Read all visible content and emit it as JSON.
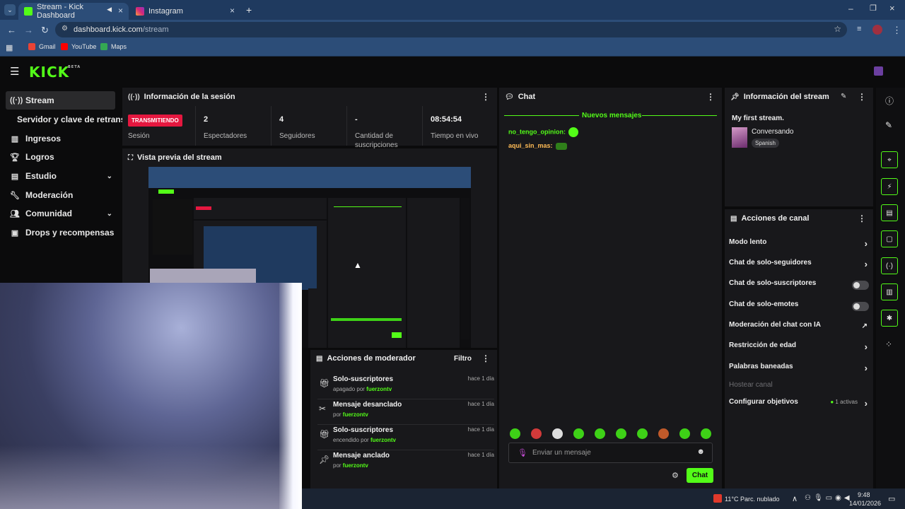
{
  "browser": {
    "tabs": [
      {
        "title": "Stream - Kick Dashboard",
        "active": true
      },
      {
        "title": "Instagram",
        "active": false
      }
    ],
    "url_host": "dashboard.kick.com",
    "url_path": "/stream",
    "bookmarks": [
      "Gmail",
      "YouTube",
      "Maps"
    ]
  },
  "kick": {
    "logo": "KICK",
    "beta": "BETA"
  },
  "sidebar": {
    "items": [
      {
        "label": "Stream",
        "icon": "broadcast-icon"
      },
      {
        "label": "Servidor y clave de retransm",
        "icon": ""
      },
      {
        "label": "Ingresos",
        "icon": "bar-chart-icon"
      },
      {
        "label": "Logros",
        "icon": "trophy-icon"
      },
      {
        "label": "Estudio",
        "icon": "studio-icon"
      },
      {
        "label": "Moderación",
        "icon": "wrench-icon"
      },
      {
        "label": "Comunidad",
        "icon": "people-icon"
      },
      {
        "label": "Drops y recompensas",
        "icon": "gift-icon"
      }
    ]
  },
  "session": {
    "title": "Información de la sesión",
    "status": "TRANSMITIENDO",
    "status_label": "Sesión",
    "stats": [
      {
        "value": "2",
        "label": "Espectadores"
      },
      {
        "value": "4",
        "label": "Seguidores"
      },
      {
        "value": "-",
        "label": "Cantidad de suscripciones"
      },
      {
        "value": "08:54:54",
        "label": "Tiempo en vivo"
      }
    ]
  },
  "preview": {
    "title": "Vista previa del stream"
  },
  "chat": {
    "title": "Chat",
    "new_messages": "Nuevos mensajes",
    "messages": [
      {
        "user": "no_tengo_opinion:",
        "color": "#53fc18"
      },
      {
        "user": "aqui_sin_mas:",
        "color": "#ffbb55"
      }
    ],
    "input_placeholder": "Enviar un mensaje",
    "send_label": "Chat"
  },
  "mod_actions": {
    "title": "Acciones de moderador",
    "filter": "Filtro",
    "items": [
      {
        "title": "Solo-suscriptores",
        "status": "apagado por",
        "user": "fuerzontv",
        "time": "hace 1 día",
        "icon": "gift-icon"
      },
      {
        "title": "Mensaje desanclado",
        "status": "por",
        "user": "fuerzontv",
        "time": "hace 1 día",
        "icon": "unpin-icon"
      },
      {
        "title": "Solo-suscriptores",
        "status": "encendido por",
        "user": "fuerzontv",
        "time": "hace 1 día",
        "icon": "gift-icon"
      },
      {
        "title": "Mensaje anclado",
        "status": "por",
        "user": "fuerzontv",
        "time": "hace 1 día",
        "icon": "pin-icon"
      }
    ]
  },
  "stream_info": {
    "title": "Información del stream",
    "stream_title": "My first stream.",
    "category": "Conversando",
    "language": "Spanish"
  },
  "channel_actions": {
    "title": "Acciones de canal",
    "rows": [
      {
        "label": "Modo lento",
        "kind": "arrow"
      },
      {
        "label": "Chat de solo-seguidores",
        "kind": "arrow"
      },
      {
        "label": "Chat de solo-suscriptores",
        "kind": "toggle"
      },
      {
        "label": "Chat de solo-emotes",
        "kind": "toggle"
      },
      {
        "label": "Moderación del chat con IA",
        "kind": "external"
      },
      {
        "label": "Restricción de edad",
        "kind": "arrow"
      },
      {
        "label": "Palabras baneadas",
        "kind": "arrow"
      },
      {
        "label": "Hostear canal",
        "kind": "disabled"
      },
      {
        "label": "Configurar objetivos",
        "kind": "arrow",
        "badge": "1 activas"
      }
    ]
  },
  "taskbar": {
    "weather": "11°C",
    "condition": "Parc. nublado",
    "time": "9:48",
    "date": "14/01/2026"
  },
  "colors": {
    "accent": "#53fc18",
    "live": "#e5173f",
    "panel": "#18181b",
    "bg": "#0b0b0c"
  }
}
